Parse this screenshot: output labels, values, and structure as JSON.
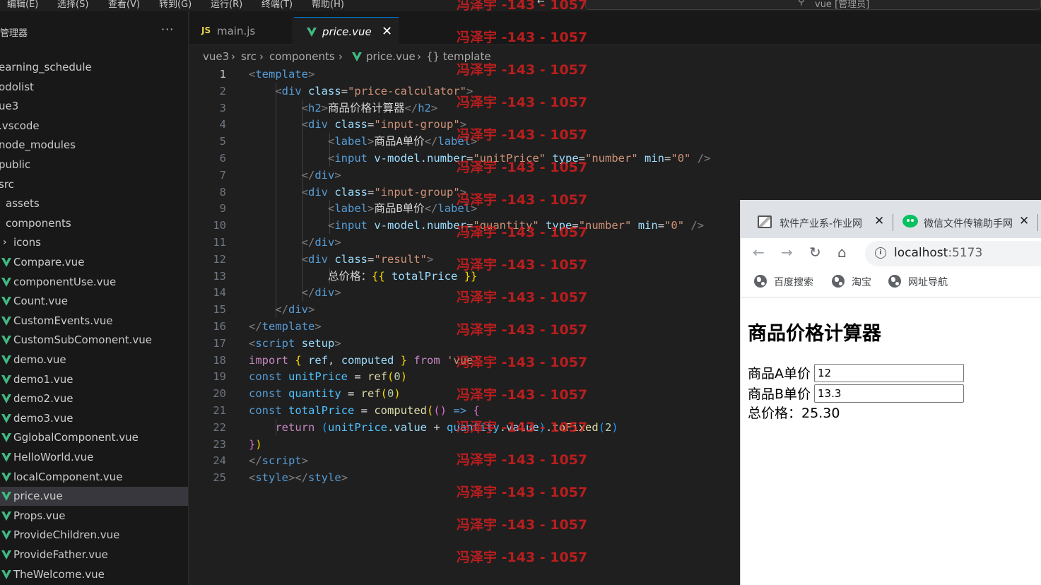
{
  "menu": [
    "编辑(E)",
    "选择(S)",
    "查看(V)",
    "转到(G)",
    "运行(R)",
    "终端(T)",
    "帮助(H)"
  ],
  "command_center": {
    "text": "vue [管理员]"
  },
  "sidebar": {
    "title": "管理器",
    "more": "···",
    "items": [
      {
        "label": "earning_schedule",
        "type": "folder"
      },
      {
        "label": "odolist",
        "type": "folder"
      },
      {
        "label": "ue3",
        "type": "folder"
      },
      {
        "label": ".vscode",
        "type": "folder"
      },
      {
        "label": "node_modules",
        "type": "folder"
      },
      {
        "label": "public",
        "type": "folder"
      },
      {
        "label": "src",
        "type": "folder"
      },
      {
        "label": "assets",
        "type": "folder"
      },
      {
        "label": "components",
        "type": "folder"
      },
      {
        "label": "icons",
        "type": "folder-collapsed"
      },
      {
        "label": "Compare.vue",
        "type": "vue"
      },
      {
        "label": "componentUse.vue",
        "type": "vue"
      },
      {
        "label": "Count.vue",
        "type": "vue"
      },
      {
        "label": "CustomEvents.vue",
        "type": "vue"
      },
      {
        "label": "CustomSubComonent.vue",
        "type": "vue"
      },
      {
        "label": "demo.vue",
        "type": "vue"
      },
      {
        "label": "demo1.vue",
        "type": "vue"
      },
      {
        "label": "demo2.vue",
        "type": "vue"
      },
      {
        "label": "demo3.vue",
        "type": "vue"
      },
      {
        "label": "GglobalComponent.vue",
        "type": "vue"
      },
      {
        "label": "HelloWorld.vue",
        "type": "vue"
      },
      {
        "label": "localComponent.vue",
        "type": "vue"
      },
      {
        "label": "price.vue",
        "type": "vue",
        "selected": true
      },
      {
        "label": "Props.vue",
        "type": "vue"
      },
      {
        "label": "ProvideChildren.vue",
        "type": "vue"
      },
      {
        "label": "ProvideFather.vue",
        "type": "vue"
      },
      {
        "label": "TheWelcome.vue",
        "type": "vue"
      }
    ]
  },
  "tabs": [
    {
      "label": "main.js",
      "icon": "JS"
    },
    {
      "label": "price.vue",
      "active": true,
      "close": "✕"
    }
  ],
  "breadcrumb": [
    "vue3",
    "src",
    "components",
    "price.vue",
    "{} template"
  ],
  "code_lines": [
    [
      [
        "tk-br",
        "<"
      ],
      [
        "tk-tag",
        "template"
      ],
      [
        "tk-br",
        ">"
      ]
    ],
    [
      [
        "",
        "    "
      ],
      [
        "tk-br",
        "<"
      ],
      [
        "tk-tag",
        "div"
      ],
      [
        "tk-txt",
        " "
      ],
      [
        "tk-attr",
        "class"
      ],
      [
        "tk-txt",
        "="
      ],
      [
        "tk-str",
        "\"price-calculator\""
      ],
      [
        "tk-br",
        ">"
      ]
    ],
    [
      [
        "",
        "        "
      ],
      [
        "tk-br",
        "<"
      ],
      [
        "tk-tag",
        "h2"
      ],
      [
        "tk-br",
        ">"
      ],
      [
        "tk-txt",
        "商品价格计算器"
      ],
      [
        "tk-br",
        "</"
      ],
      [
        "tk-tag",
        "h2"
      ],
      [
        "tk-br",
        ">"
      ]
    ],
    [
      [
        "",
        "        "
      ],
      [
        "tk-br",
        "<"
      ],
      [
        "tk-tag",
        "div"
      ],
      [
        "tk-txt",
        " "
      ],
      [
        "tk-attr",
        "class"
      ],
      [
        "tk-txt",
        "="
      ],
      [
        "tk-str",
        "\"input-group\""
      ],
      [
        "tk-br",
        ">"
      ]
    ],
    [
      [
        "",
        "            "
      ],
      [
        "tk-br",
        "<"
      ],
      [
        "tk-tag",
        "label"
      ],
      [
        "tk-br",
        ">"
      ],
      [
        "tk-txt",
        "商品A单价"
      ],
      [
        "tk-br",
        "</"
      ],
      [
        "tk-tag",
        "label"
      ],
      [
        "tk-br",
        ">"
      ]
    ],
    [
      [
        "",
        "            "
      ],
      [
        "tk-br",
        "<"
      ],
      [
        "tk-tag",
        "input"
      ],
      [
        "tk-txt",
        " "
      ],
      [
        "tk-attr",
        "v-model.number"
      ],
      [
        "tk-txt",
        "="
      ],
      [
        "tk-str",
        "\"unitPrice\""
      ],
      [
        "tk-txt",
        " "
      ],
      [
        "tk-attr",
        "type"
      ],
      [
        "tk-txt",
        "="
      ],
      [
        "tk-str",
        "\"number\""
      ],
      [
        "tk-txt",
        " "
      ],
      [
        "tk-attr",
        "min"
      ],
      [
        "tk-txt",
        "="
      ],
      [
        "tk-str",
        "\"0\""
      ],
      [
        "tk-txt",
        " "
      ],
      [
        "tk-br",
        "/>"
      ]
    ],
    [
      [
        "",
        "        "
      ],
      [
        "tk-br",
        "</"
      ],
      [
        "tk-tag",
        "div"
      ],
      [
        "tk-br",
        ">"
      ]
    ],
    [
      [
        "",
        "        "
      ],
      [
        "tk-br",
        "<"
      ],
      [
        "tk-tag",
        "div"
      ],
      [
        "tk-txt",
        " "
      ],
      [
        "tk-attr",
        "class"
      ],
      [
        "tk-txt",
        "="
      ],
      [
        "tk-str",
        "\"input-group\""
      ],
      [
        "tk-br",
        ">"
      ]
    ],
    [
      [
        "",
        "            "
      ],
      [
        "tk-br",
        "<"
      ],
      [
        "tk-tag",
        "label"
      ],
      [
        "tk-br",
        ">"
      ],
      [
        "tk-txt",
        "商品B单价"
      ],
      [
        "tk-br",
        "</"
      ],
      [
        "tk-tag",
        "label"
      ],
      [
        "tk-br",
        ">"
      ]
    ],
    [
      [
        "",
        "            "
      ],
      [
        "tk-br",
        "<"
      ],
      [
        "tk-tag",
        "input"
      ],
      [
        "tk-txt",
        " "
      ],
      [
        "tk-attr",
        "v-model.number"
      ],
      [
        "tk-txt",
        "="
      ],
      [
        "tk-str",
        "\"quantity\""
      ],
      [
        "tk-txt",
        " "
      ],
      [
        "tk-attr",
        "type"
      ],
      [
        "tk-txt",
        "="
      ],
      [
        "tk-str",
        "\"number\""
      ],
      [
        "tk-txt",
        " "
      ],
      [
        "tk-attr",
        "min"
      ],
      [
        "tk-txt",
        "="
      ],
      [
        "tk-str",
        "\"0\""
      ],
      [
        "tk-txt",
        " "
      ],
      [
        "tk-br",
        "/>"
      ]
    ],
    [
      [
        "",
        "        "
      ],
      [
        "tk-br",
        "</"
      ],
      [
        "tk-tag",
        "div"
      ],
      [
        "tk-br",
        ">"
      ]
    ],
    [
      [
        "",
        "        "
      ],
      [
        "tk-br",
        "<"
      ],
      [
        "tk-tag",
        "div"
      ],
      [
        "tk-txt",
        " "
      ],
      [
        "tk-attr",
        "class"
      ],
      [
        "tk-txt",
        "="
      ],
      [
        "tk-str",
        "\"result\""
      ],
      [
        "tk-br",
        ">"
      ]
    ],
    [
      [
        "",
        "            "
      ],
      [
        "tk-txt",
        "总价格："
      ],
      [
        "tk-b1",
        "{{"
      ],
      [
        "tk-txt",
        " "
      ],
      [
        "tk-id",
        "totalPrice"
      ],
      [
        "tk-txt",
        " "
      ],
      [
        "tk-b1",
        "}}"
      ]
    ],
    [
      [
        "",
        "        "
      ],
      [
        "tk-br",
        "</"
      ],
      [
        "tk-tag",
        "div"
      ],
      [
        "tk-br",
        ">"
      ]
    ],
    [
      [
        "",
        "    "
      ],
      [
        "tk-br",
        "</"
      ],
      [
        "tk-tag",
        "div"
      ],
      [
        "tk-br",
        ">"
      ]
    ],
    [
      [
        "tk-br",
        "</"
      ],
      [
        "tk-tag",
        "template"
      ],
      [
        "tk-br",
        ">"
      ]
    ],
    [
      [
        "tk-br",
        "<"
      ],
      [
        "tk-tag",
        "script"
      ],
      [
        "tk-txt",
        " "
      ],
      [
        "tk-attr",
        "setup"
      ],
      [
        "tk-br",
        ">"
      ]
    ],
    [
      [
        "tk-kw",
        "import"
      ],
      [
        "tk-txt",
        " "
      ],
      [
        "tk-b1",
        "{"
      ],
      [
        "tk-txt",
        " "
      ],
      [
        "tk-id",
        "ref"
      ],
      [
        "tk-txt",
        ", "
      ],
      [
        "tk-id",
        "computed"
      ],
      [
        "tk-txt",
        " "
      ],
      [
        "tk-b1",
        "}"
      ],
      [
        "tk-txt",
        " "
      ],
      [
        "tk-kw",
        "from"
      ],
      [
        "tk-txt",
        " "
      ],
      [
        "tk-str",
        "'vue'"
      ]
    ],
    [
      [
        "tk-decl",
        "const"
      ],
      [
        "tk-txt",
        " "
      ],
      [
        "tk-var",
        "unitPrice"
      ],
      [
        "tk-txt",
        " = "
      ],
      [
        "tk-fn",
        "ref"
      ],
      [
        "tk-b1",
        "("
      ],
      [
        "tk-num",
        "0"
      ],
      [
        "tk-b1",
        ")"
      ]
    ],
    [
      [
        "tk-decl",
        "const"
      ],
      [
        "tk-txt",
        " "
      ],
      [
        "tk-var",
        "quantity"
      ],
      [
        "tk-txt",
        " = "
      ],
      [
        "tk-fn",
        "ref"
      ],
      [
        "tk-b1",
        "("
      ],
      [
        "tk-num",
        "0"
      ],
      [
        "tk-b1",
        ")"
      ]
    ],
    [
      [
        "tk-decl",
        "const"
      ],
      [
        "tk-txt",
        " "
      ],
      [
        "tk-var",
        "totalPrice"
      ],
      [
        "tk-txt",
        " = "
      ],
      [
        "tk-fn",
        "computed"
      ],
      [
        "tk-b1",
        "("
      ],
      [
        "tk-b2",
        "()"
      ],
      [
        "tk-txt",
        " "
      ],
      [
        "tk-decl",
        "=>"
      ],
      [
        "tk-txt",
        " "
      ],
      [
        "tk-b2",
        "{"
      ]
    ],
    [
      [
        "",
        "    "
      ],
      [
        "tk-kw",
        "return"
      ],
      [
        "tk-txt",
        " "
      ],
      [
        "tk-b3",
        "("
      ],
      [
        "tk-var",
        "unitPrice"
      ],
      [
        "tk-txt",
        "."
      ],
      [
        "tk-id",
        "value"
      ],
      [
        "tk-txt",
        " + "
      ],
      [
        "tk-var",
        "quantity"
      ],
      [
        "tk-txt",
        "."
      ],
      [
        "tk-id",
        "value"
      ],
      [
        "tk-b3",
        ")"
      ],
      [
        "tk-txt",
        "."
      ],
      [
        "tk-fn",
        "toFixed"
      ],
      [
        "tk-b3",
        "("
      ],
      [
        "tk-num",
        "2"
      ],
      [
        "tk-b3",
        ")"
      ]
    ],
    [
      [
        "tk-b2",
        "}"
      ],
      [
        "tk-b1",
        ")"
      ]
    ],
    [
      [
        "tk-br",
        "</"
      ],
      [
        "tk-tag",
        "script"
      ],
      [
        "tk-br",
        ">"
      ]
    ],
    [
      [
        "tk-br",
        "<"
      ],
      [
        "tk-tag",
        "style"
      ],
      [
        "tk-br",
        "></"
      ],
      [
        "tk-tag",
        "style"
      ],
      [
        "tk-br",
        ">"
      ]
    ]
  ],
  "watermark": "冯泽宇 -143 - 1057",
  "browser": {
    "tabs": [
      {
        "label": "软件产业系-作业网",
        "close": "✕"
      },
      {
        "label": "微信文件传输助手网",
        "close": "✕"
      }
    ],
    "nav": {
      "back": "←",
      "forward": "→",
      "reload": "↻",
      "home": "⌂"
    },
    "url_host": "localhost",
    "url_port": ":5173",
    "bookmarks": [
      "百度搜索",
      "淘宝",
      "网址导航"
    ],
    "page": {
      "heading": "商品价格计算器",
      "label_a": "商品A单价",
      "value_a": "12",
      "label_b": "商品B单价",
      "value_b": "13.3",
      "result_label": "总价格：",
      "result_value": "25.30"
    }
  }
}
